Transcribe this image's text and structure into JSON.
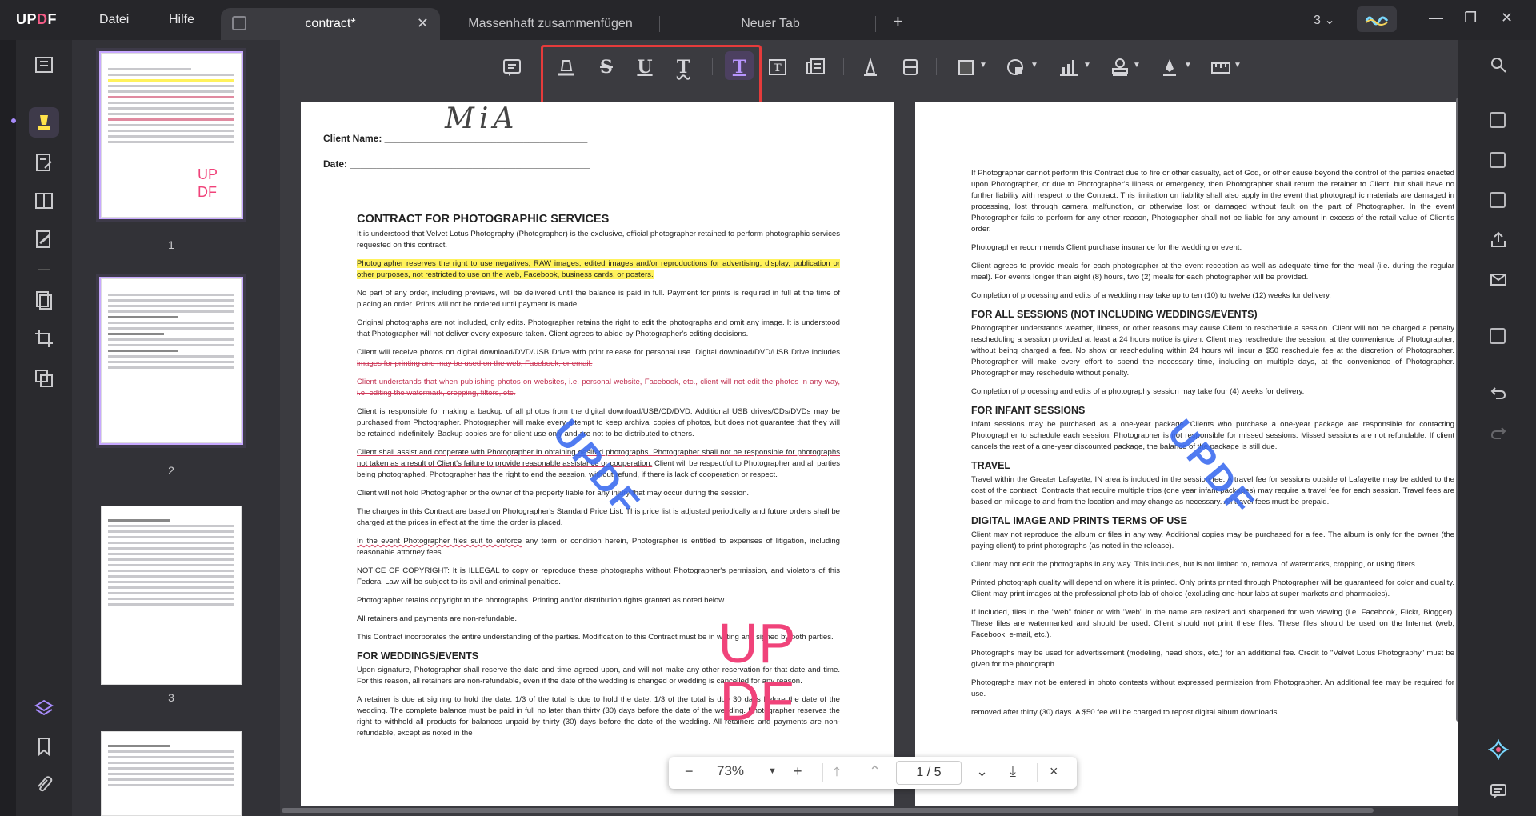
{
  "app": {
    "logo": "UPDF"
  },
  "menu": {
    "file": "Datei",
    "help": "Hilfe"
  },
  "tabs": [
    {
      "label": "contract*"
    },
    {
      "label": "Massenhaft zusammenfügen"
    },
    {
      "label": "Neuer Tab"
    }
  ],
  "window": {
    "count": "3"
  },
  "thumbnails": [
    {
      "num": "1"
    },
    {
      "num": "2"
    },
    {
      "num": "3"
    }
  ],
  "page1": {
    "signature": "MiA",
    "client_name": "Client Name: ______________________________________",
    "date": "Date: _____________________________________________",
    "title": "CONTRACT FOR PHOTOGRAPHIC SERVICES",
    "p1": "It is understood that Velvet Lotus Photography (Photographer) is the exclusive, official photographer retained to perform photographic services requested on this contract.",
    "p2": "Photographer reserves the right to use negatives, RAW images, edited images and/or reproductions for advertising, display, publication or other purposes, not restricted to use on the web, Facebook, business cards, or posters.",
    "p3": "No part of any order, including previews, will be delivered until the balance is paid in full. Payment for prints is required in full at the time of placing an order. Prints will not be ordered until payment is made.",
    "p4": "Original photographs are not included, only edits. Photographer retains the right to edit the photographs and omit any image. It is understood that Photographer will not deliver every exposure taken. Client agrees to abide by Photographer's editing decisions.",
    "p5a": "Client will receive photos on digital download/DVD/USB Drive with print release for personal use. Digital download/DVD/USB Drive includes",
    "p5b": "images for printing and may be used on the web, Facebook, or email.",
    "p6": "Client understands that when publishing photos on websites, i.e. personal website, Facebook, etc., client will not edit the photos in any way, i.e. editing the watermark, cropping, filters, etc.",
    "p7": "Client is responsible for making a backup of all photos from the digital download/USB/CD/DVD. Additional USB drives/CDs/DVDs may be purchased from Photographer. Photographer will make every attempt to keep archival copies of photos, but does not guarantee that they will be retained indefinitely. Backup copies are for client use only and are not to be distributed to others.",
    "p8a": "Client shall assist and cooperate with Photographer in obtaining desired photographs. Photographer shall not be responsible for photographs not taken as a result of Client's failure to provide reasonable assistance or cooperation.",
    "p8b": "Client will be respectful to Photographer and all parties being photographed. Photographer has the right to end the session, without refund, if there is lack of cooperation or respect.",
    "p9": "Client will not hold Photographer or the owner of the property liable for any injury that may occur during the session.",
    "p10a": "The charges in this Contract are based on Photographer's Standard Price List. This price list is adjusted periodically and future orders shall be",
    "p10b": "charged at the prices in effect at the time the order is placed.",
    "p11a": "In the event Photographer files suit to enforce",
    "p11b": "any term or condition herein, Photographer is entitled to expenses of litigation, including reasonable attorney fees.",
    "p12": "NOTICE OF COPYRIGHT: It is ILLEGAL to copy or reproduce these photographs without Photographer's permission, and violators of this Federal Law will be subject to its civil and criminal penalties.",
    "p13": "Photographer retains copyright to the photographs. Printing and/or distribution rights granted as noted below.",
    "p14": "All retainers and payments are non-refundable.",
    "p15": "This Contract incorporates the entire understanding of the parties. Modification to this Contract must be in writing and signed by both parties.",
    "h_wed": "FOR WEDDINGS/EVENTS",
    "p16": "Upon signature, Photographer shall reserve the date and time agreed upon, and will not make any other reservation for that date and time. For this reason, all retainers are non-refundable, even if the date of the wedding is changed or wedding is cancelled for any reason.",
    "p17": "A retainer is due at signing to hold the date. 1/3 of the total is due to hold the date. 1/3 of the total is due 30 days before the date of the wedding. The complete balance must be paid in full no later than thirty (30) days before the date of the wedding. Photographer reserves the right to withhold all products for balances unpaid by thirty (30) days before the date of the wedding. All retainers and payments are non-refundable, except as noted in the",
    "wm_diag": "UPDF",
    "wm_big": "UP DF"
  },
  "page2": {
    "p1": "If Photographer cannot perform this Contract due to fire or other casualty, act of God, or other cause beyond the control of the parties enacted upon Photographer, or due to Photographer's illness or emergency, then Photographer shall return the retainer to Client, but shall have no further liability with respect to the Contract. This limitation on liability shall also apply in the event that photographic materials are damaged in processing, lost through camera malfunction, or otherwise lost or damaged without fault on the part of Photographer. In the event Photographer fails to perform for any other reason, Photographer shall not be liable for any amount in excess of the retail value of Client's order.",
    "p2": "Photographer recommends Client purchase insurance for the wedding or event.",
    "p3": "Client agrees to provide meals for each photographer at the event reception as well as adequate time for the meal (i.e. during the regular meal). For events longer than eight (8) hours, two (2) meals for each photographer will be provided.",
    "p4": "Completion of processing and edits of a wedding may take up to ten (10) to twelve (12) weeks for delivery.",
    "h1": "FOR ALL SESSIONS (NOT INCLUDING WEDDINGS/EVENTS)",
    "p5": "Photographer understands weather, illness, or other reasons may cause Client to reschedule a session. Client will not be charged a penalty rescheduling a session provided at least a 24 hours notice is given. Client may reschedule the session, at the convenience of Photographer, without being charged a fee. No show or rescheduling within 24 hours will incur a $50 reschedule fee at the discretion of Photographer. Photographer will make every effort to spend the necessary time, including on multiple days, at the convenience of Photographer. Photographer may reschedule without penalty.",
    "p6": "Completion of processing and edits of a photography session may take four (4) weeks for delivery.",
    "h2": "FOR INFANT SESSIONS",
    "p7": "Infant sessions may be purchased as a one-year package. Clients who purchase a one-year package are responsible for contacting Photographer to schedule each session. Photographer is not responsible for missed sessions. Missed sessions are not refundable. If client cancels the rest of a one-year discounted package, the balance of the package is still due.",
    "h3": "TRAVEL",
    "p8": "Travel within the Greater Lafayette, IN area is included in the session fee. A travel fee for sessions outside of Lafayette may be added to the cost of the contract. Contracts that require multiple trips (one year infant packages) may require a travel fee for each session. Travel fees are based on mileage to and from the location and may change as necessary. All travel fees must be prepaid.",
    "h4": "DIGITAL IMAGE AND PRINTS TERMS OF USE",
    "p9": "Client may not reproduce the album or files in any way. Additional copies may be purchased for a fee. The album is only for the owner (the paying client) to print photographs (as noted in the release).",
    "p10": "Client may not edit the photographs in any way. This includes, but is not limited to, removal of watermarks, cropping, or using filters.",
    "p11": "Printed photograph quality will depend on where it is printed. Only prints printed through Photographer will be guaranteed for color and quality. Client may print images at the professional photo lab of choice (excluding one-hour labs at super markets and pharmacies).",
    "p12": "If included, files in the \"web\" folder or with \"web\" in the name are resized and sharpened for web viewing (i.e. Facebook, Flickr, Blogger). These files are watermarked and should be used. Client should not print these files. These files should be used on the Internet (web, Facebook, e-mail, etc.).",
    "p13": "Photographs may be used for advertisement (modeling, head shots, etc.) for an additional fee. Credit to \"Velvet Lotus Photography\" must be given for the photograph.",
    "p14": "Photographs may not be entered in photo contests without expressed permission from Photographer. An additional fee may be required for use.",
    "p15": "removed after thirty (30) days. A $50 fee will be charged to repost digital album downloads.",
    "wm_diag": "UPDF"
  },
  "zoom": {
    "level": "73%",
    "page_current": "1",
    "page_sep": "/",
    "page_total": "5"
  },
  "icons": {
    "minus": "−",
    "plus": "+",
    "close": "×",
    "first": "⤒",
    "prev": "⌃",
    "next": "⌄",
    "last": "⤓"
  },
  "colors": {
    "accent": "#c7a8ff",
    "highlight": "#fff25c",
    "annotation": "#d43c5c",
    "watermark_blue": "#3e6df0",
    "watermark_pink": "#f0437a",
    "red_box": "#e53b3b"
  }
}
